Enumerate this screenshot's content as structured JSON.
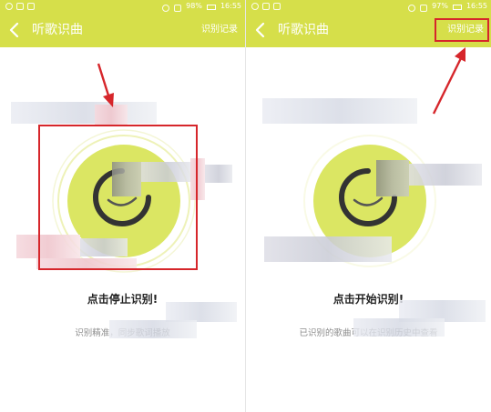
{
  "colors": {
    "accent": "#d6df4a",
    "disc": "#dbe663",
    "annotation": "#d6262b"
  },
  "screens": [
    {
      "status": {
        "battery": "98%",
        "time": "16:55"
      },
      "title": "听歌识曲",
      "history_label": "识别记录",
      "main_text": "点击停止识别!",
      "sub_text": "识别精准，同步歌词播放",
      "icons": [
        "back-icon",
        "record-needle-icon"
      ]
    },
    {
      "status": {
        "battery": "97%",
        "time": "16:55"
      },
      "title": "听歌识曲",
      "history_label": "识别记录",
      "main_text": "点击开始识别!",
      "sub_text": "已识别的歌曲可以在识别历史中查看",
      "icons": [
        "back-icon",
        "record-needle-icon"
      ]
    }
  ]
}
